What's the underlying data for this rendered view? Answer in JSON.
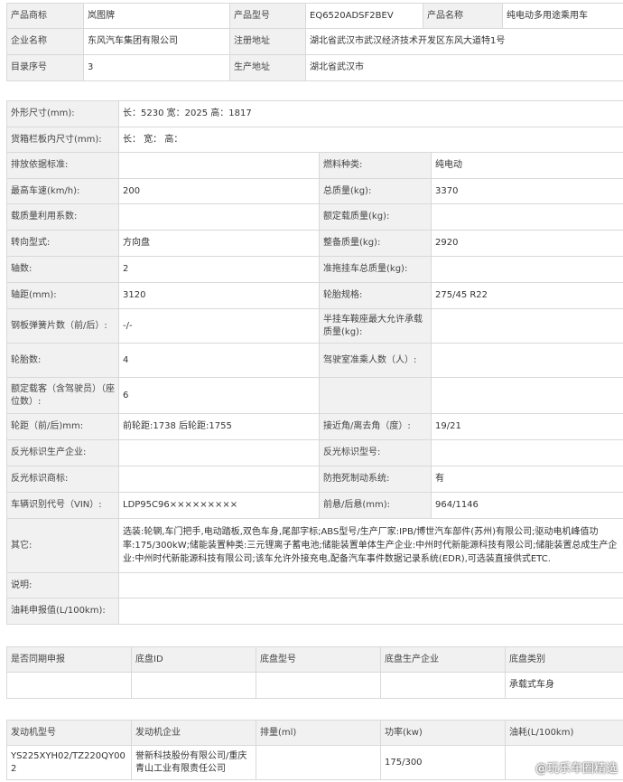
{
  "top": {
    "brand_label": "产品商标",
    "brand_value": "岚图牌",
    "model_label": "产品型号",
    "model_value": "EQ6520ADSF2BEV",
    "name_label": "产品名称",
    "name_value": "纯电动多用途乘用车",
    "company_label": "企业名称",
    "company_value": "东风汽车集团有限公司",
    "reg_addr_label": "注册地址",
    "reg_addr_value": "湖北省武汉市武汉经济技术开发区东风大道特1号",
    "catalog_label": "目录序号",
    "catalog_value": "3",
    "prod_addr_label": "生产地址",
    "prod_addr_value": "湖北省武汉市"
  },
  "specs": {
    "dims_label": "外形尺寸(mm):",
    "dims_value": "长：5230 宽：2025 高：1817",
    "cargo_label": "货箱栏板内尺寸(mm):",
    "cargo_value": "长： 宽： 高：",
    "emission_label": "排放依据标准:",
    "emission_value": "",
    "fuel_label": "燃料种类:",
    "fuel_value": "纯电动",
    "speed_label": "最高车速(km/h):",
    "speed_value": "200",
    "total_mass_label": "总质量(kg):",
    "total_mass_value": "3370",
    "load_util_label": "载质量利用系数:",
    "load_util_value": "",
    "rated_load_label": "额定载质量(kg):",
    "rated_load_value": "",
    "steering_label": "转向型式:",
    "steering_value": "方向盘",
    "curb_label": "整备质量(kg):",
    "curb_value": "2920",
    "axles_label": "轴数:",
    "axles_value": "2",
    "trailer_label": "准拖挂车总质量(kg):",
    "trailer_value": "",
    "wheelbase_label": "轴距(mm):",
    "wheelbase_value": "3120",
    "tire_label": "轮胎规格:",
    "tire_value": "275/45 R22",
    "spring_label": "钢板弹簧片数（前/后）:",
    "spring_value": "-/-",
    "saddle_label": "半挂车鞍座最大允许承载质量(kg):",
    "saddle_value": "",
    "tires_label": "轮胎数:",
    "tires_value": "4",
    "cab_label": "驾驶室准乘人数（人）:",
    "cab_value": "",
    "seats_label": "额定载客（含驾驶员）（座位数）:",
    "seats_value": "6",
    "track_label": "轮距（前/后)mm:",
    "track_value": "前轮距:1738 后轮距:1755",
    "angle_label": "接近角/离去角（度）:",
    "angle_value": "19/21",
    "refl_company_label": "反光标识生产企业:",
    "refl_company_value": "",
    "refl_model_label": "反光标识型号:",
    "refl_model_value": "",
    "refl_brand_label": "反光标识商标:",
    "refl_brand_value": "",
    "abs_label": "防抱死制动系统:",
    "abs_value": "有",
    "vin_label": "车辆识别代号（VIN）:",
    "vin_value": "LDP95C96×××××××××",
    "overhang_label": "前悬/后悬(mm):",
    "overhang_value": "964/1146",
    "other_label": "其它:",
    "other_value": "选装:轮辋,车门把手,电动踏板,双色车身,尾部字标;ABS型号/生产厂家:IPB/博世汽车部件(苏州)有限公司;驱动电机峰值功率:175/300kW;储能装置种类:三元锂离子蓄电池;储能装置单体生产企业:中州时代新能源科技有限公司;储能装置总成生产企业:中州时代新能源科技有限公司;该车允许外接充电,配备汽车事件数据记录系统(EDR),可选装直接供式ETC.",
    "note_label": "说明:",
    "note_value": "",
    "fuel_cons_label": "油耗申报值(L/100km):",
    "fuel_cons_value": ""
  },
  "chassis": {
    "headers": [
      "是否同期申报",
      "底盘ID",
      "底盘型号",
      "底盘生产企业",
      "底盘类别"
    ],
    "row": [
      "",
      "",
      "",
      "",
      "承载式车身"
    ]
  },
  "engine": {
    "headers": [
      "发动机型号",
      "发动机企业",
      "排量(ml)",
      "功率(kw)",
      "油耗(L/100km)"
    ],
    "row": [
      "YS225XYH02/TZ220QY002",
      "誉新科技股份有限公司/重庆青山工业有限责任公司",
      "",
      "175/300",
      ""
    ]
  },
  "watermark": "@玩乐车圈精选",
  "colors": {
    "label_bg": "#f1f1f1",
    "border": "#d9d9d9",
    "text": "#333333"
  }
}
